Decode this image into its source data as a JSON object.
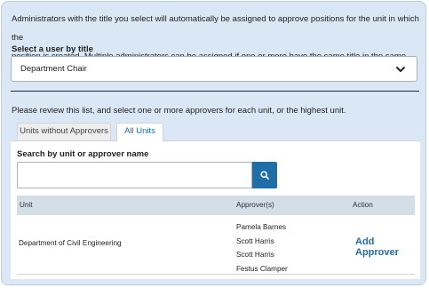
{
  "intro": {
    "line1": "Administrators with the title you select will automatically be assigned to approve positions for the unit in which the",
    "line2": "position is created. Multiple administrators can be assigned if one or more have the same title in the same unit."
  },
  "title_select": {
    "label": "Select a user by title",
    "value": "Department Chair",
    "icon": "chevron-down-icon"
  },
  "review_text": "Please review this list, and select one or more approvers for each unit, or the highest unit.",
  "tabs": [
    {
      "label": "Units without Approvers",
      "active": false
    },
    {
      "label": "All Units",
      "active": true
    }
  ],
  "search": {
    "label": "Search by unit or approver name",
    "value": "",
    "placeholder": "",
    "icon": "search-icon"
  },
  "table": {
    "columns": [
      "Unit",
      "Approver(s)",
      "Action"
    ],
    "rows": [
      {
        "unit": "Department of Civil Engineering",
        "approvers": [
          "Pamela Barnes",
          "Scott Harris",
          "Scott Harris",
          "Festus Clamper"
        ],
        "action": "Add Approver"
      }
    ]
  },
  "colors": {
    "panel_background": "#d9e8f4",
    "accent": "#1e6fa8",
    "table_header": "#d3dee7"
  }
}
